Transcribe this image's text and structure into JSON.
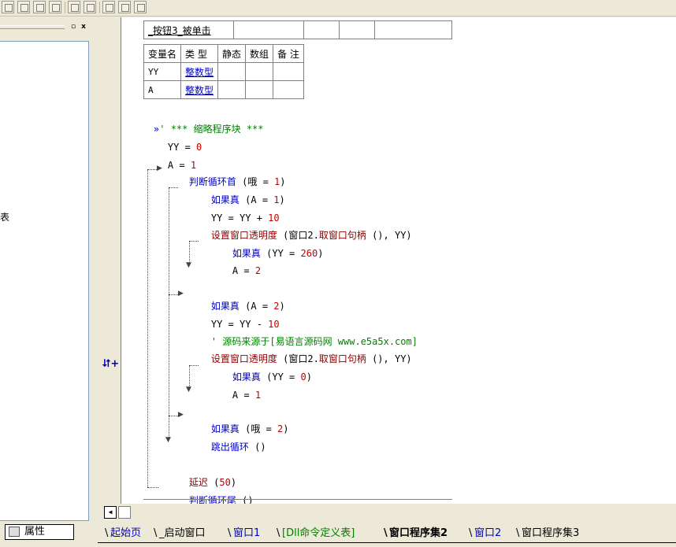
{
  "sub_table": {
    "name": "_按钮3_被单击"
  },
  "var_table": {
    "headers": [
      "变量名",
      "类 型",
      "静态",
      "数组",
      "备 注"
    ],
    "rows": [
      {
        "name": "YY",
        "type": "整数型"
      },
      {
        "name": "A",
        "type": "整数型"
      }
    ]
  },
  "code": {
    "comment_block": "' *** 缩略程序块 ***",
    "l1_lhs": "YY",
    "l1_op": " = ",
    "l1_rhs": "0",
    "l2_lhs": "A",
    "l2_op": " = ",
    "l2_rhs": "1",
    "loop_head_kw": "判断循环首",
    "loop_head_args": " (哦 = ",
    "loop_head_num": "1",
    "loop_head_end": ")",
    "if1_kw": "如果真",
    "if1_args": " (A = ",
    "if1_num": "1",
    "if1_end": ")",
    "l3_text": "YY = YY + ",
    "l3_num": "10",
    "l4_fn": "设置窗口透明度",
    "l4_open": " (窗口2.",
    "l4_fn2": "取窗口句柄",
    "l4_args": " (), YY)",
    "if2_kw": "如果真",
    "if2_args": " (YY = ",
    "if2_num": "260",
    "if2_end": ")",
    "l5_text": "A = ",
    "l5_num": "2",
    "if3_kw": "如果真",
    "if3_args": " (A = ",
    "if3_num": "2",
    "if3_end": ")",
    "l6_text": "YY = YY - ",
    "l6_num": "10",
    "l7_comment": "' 源码来源于[易语言源码网 www.e5a5x.com]",
    "l8_fn": "设置窗口透明度",
    "l8_open": " (窗口2.",
    "l8_fn2": "取窗口句柄",
    "l8_args": " (), YY)",
    "if4_kw": "如果真",
    "if4_args": " (YY = ",
    "if4_num": "0",
    "if4_end": ")",
    "l9_text": "A = ",
    "l9_num": "1",
    "if5_kw": "如果真",
    "if5_args": " (哦 = ",
    "if5_num": "2",
    "if5_end": ")",
    "l10_kw": "跳出循环",
    "l10_args": " ()",
    "l11_kw": "延迟",
    "l11_args": " (",
    "l11_num": "50",
    "l11_end": ")",
    "loop_tail_kw": "判断循环尾",
    "loop_tail_args": " ()"
  },
  "gutter": {
    "marker": "⮃+"
  },
  "dock": {
    "edge_char": "表",
    "min_btn": "▫",
    "close_btn": "x"
  },
  "property_tab": {
    "label": "属性"
  },
  "tabs": [
    {
      "label": "起始页"
    },
    {
      "label": "_启动窗口"
    },
    {
      "label": "窗口1"
    },
    {
      "label": "[Dll命令定义表]"
    },
    {
      "label": "窗口程序集2"
    },
    {
      "label": "窗口2"
    },
    {
      "label": "窗口程序集3"
    }
  ],
  "colors": {
    "keyword": "#0000c0",
    "function": "#8b0000",
    "comment": "#008000",
    "number": "#c00000"
  }
}
